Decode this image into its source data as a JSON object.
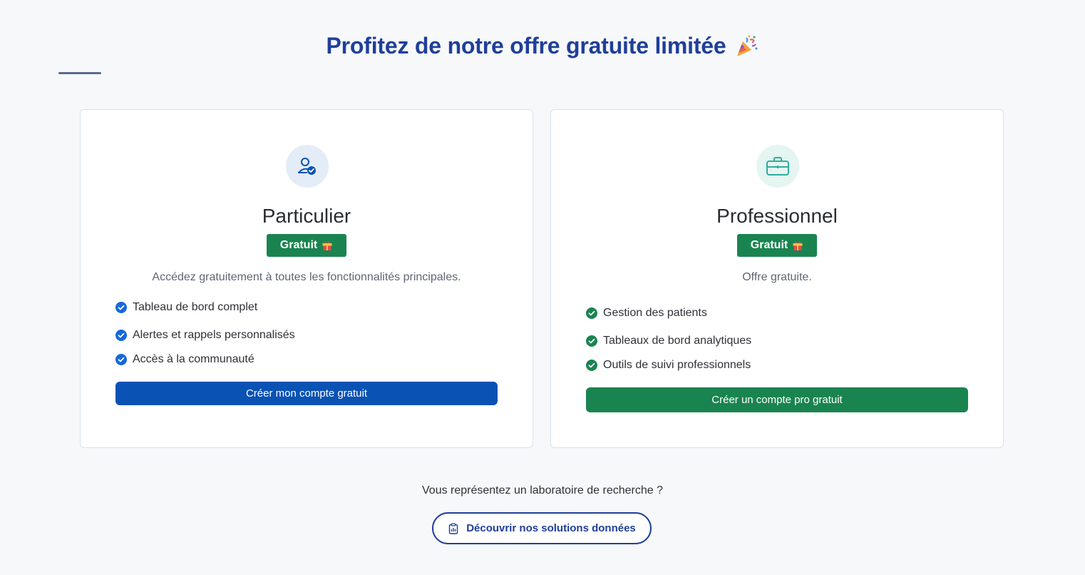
{
  "header": {
    "title": "Profitez de notre offre gratuite limitée"
  },
  "plans": {
    "individual": {
      "icon": "user-check-icon",
      "title": "Particulier",
      "badge": "Gratuit",
      "description": "Accédez gratuitement à toutes les fonctionnalités principales.",
      "features": [
        "Tableau de bord complet",
        "Alertes et rappels personnalisés",
        "Accès à la communauté"
      ],
      "cta": "Créer mon compte gratuit",
      "accent": "#0a52b4"
    },
    "professional": {
      "icon": "briefcase-icon",
      "title": "Professionnel",
      "badge": "Gratuit",
      "description": "Offre gratuite.",
      "features": [
        "Gestion des patients",
        "Tableaux de bord analytiques",
        "Outils de suivi professionnels"
      ],
      "cta": "Créer un compte pro gratuit",
      "accent": "#1a8450"
    }
  },
  "research": {
    "question": "Vous représentez un laboratoire de recherche ?",
    "button": "Découvrir nos solutions données"
  },
  "colors": {
    "title": "#1f3f99",
    "badge": "#1a8450",
    "background": "#f7f8fa"
  }
}
